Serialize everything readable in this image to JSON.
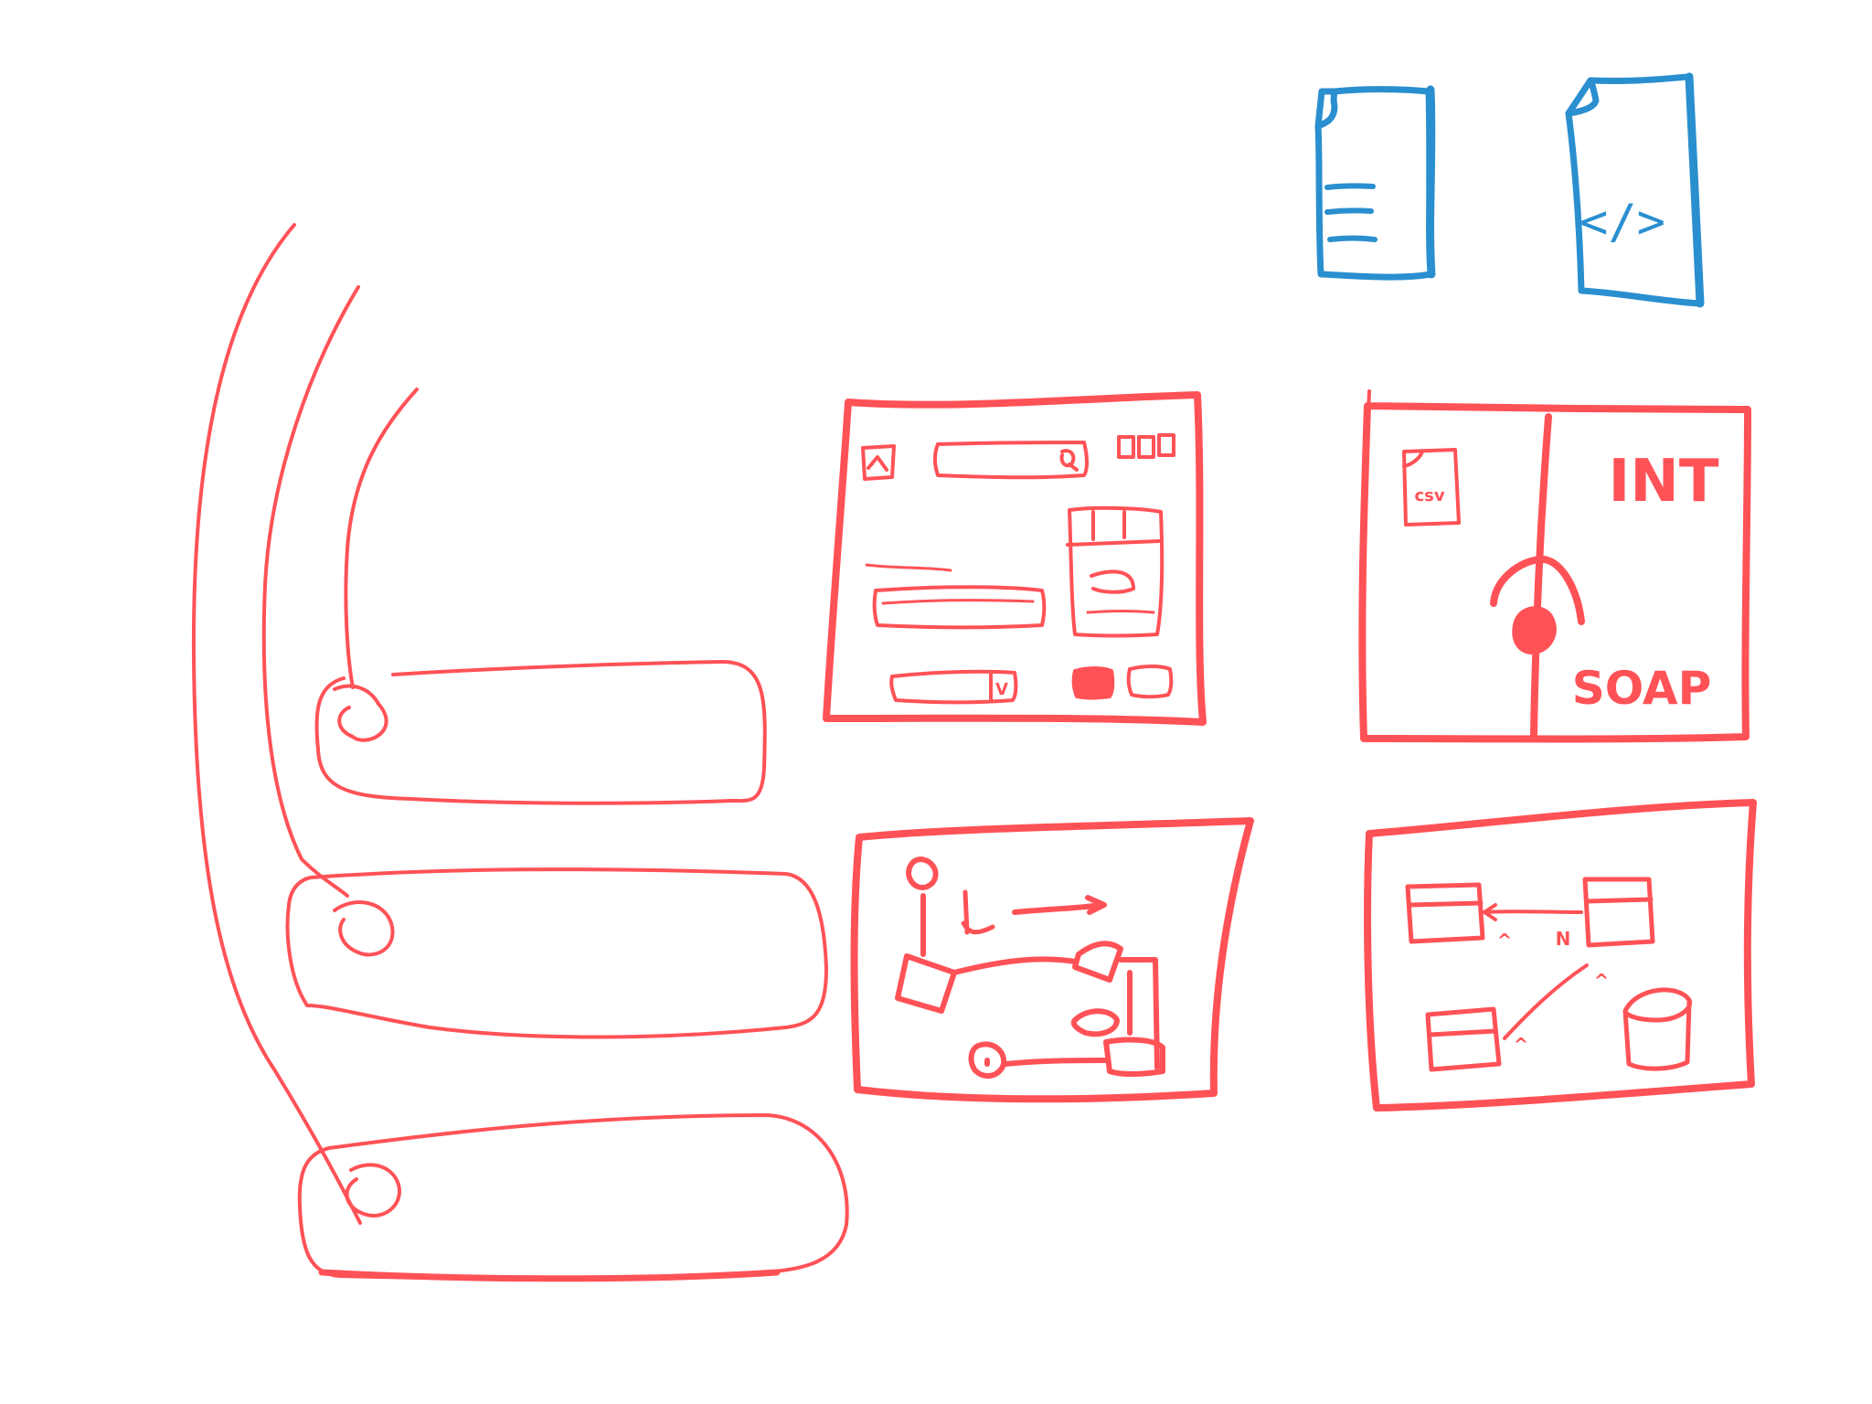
{
  "colors": {
    "sketch_red": "#ff5257",
    "sketch_blue": "#2a8fcf",
    "background": "#ffffff"
  },
  "icons": {
    "text_document": "text-document-icon",
    "code_document": "code-document-icon",
    "csv_file": "csv-file-icon",
    "database": "database-icon"
  },
  "cards": {
    "form_panel": {
      "dropdown_glyph": "V"
    },
    "integration_panel": {
      "csv_label": "csv",
      "integration_label": "INT",
      "protocol_label": "SOAP"
    },
    "schema_panel": {
      "relation_many": "N",
      "relation_one_a": "^",
      "relation_one_b": "^",
      "relation_one_c": "^"
    }
  },
  "code_document": {
    "glyph": "</>"
  }
}
